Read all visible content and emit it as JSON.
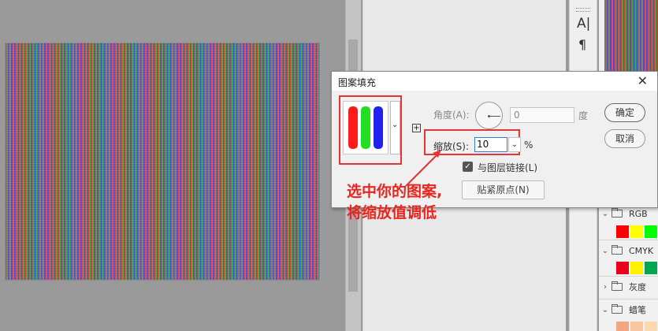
{
  "dialog": {
    "title": "图案填充",
    "close_icon": "close-icon",
    "angle_label": "角度(A):",
    "angle_value": "0",
    "angle_unit": "度",
    "scale_label": "缩放(S):",
    "scale_value": "10",
    "scale_unit": "%",
    "link_label": "与图层链接(L)",
    "link_checked": true,
    "snap_button": "贴紧原点(N)",
    "ok_button": "确定",
    "cancel_button": "取消",
    "pattern_colors": [
      "#ff1a1a",
      "#22dd22",
      "#2222ee"
    ]
  },
  "annotation": {
    "line1": "选中你的图案,",
    "line2": "将缩放值调低",
    "color": "#e8261f"
  },
  "toolstrip": {
    "character_icon": "A|",
    "paragraph_icon": "¶"
  },
  "panel": {
    "groups": [
      {
        "label": "RGB",
        "swatches": [
          "#ff0000",
          "#ffff00",
          "#00ff00"
        ]
      },
      {
        "label": "CMYK",
        "swatches": [
          "#e8001c",
          "#fff200",
          "#00a650"
        ]
      },
      {
        "label": "灰度",
        "swatches": []
      },
      {
        "label": "蜡笔",
        "swatches": [
          "#f4a582",
          "#f7c59f",
          "#fbd9b0"
        ]
      }
    ]
  }
}
